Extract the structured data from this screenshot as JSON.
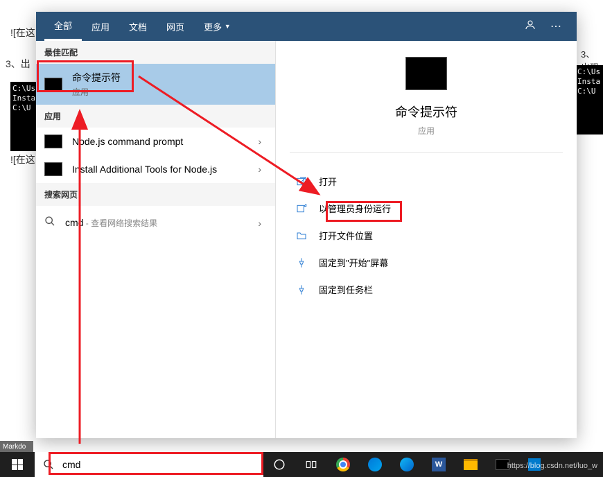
{
  "bg": {
    "text1": "![在这",
    "text2": "3、出",
    "text3": "3、出现",
    "text4": "![在这",
    "term1": "C:\\Us\nInsta\nC:\\U",
    "term2": "C:\\Us\nInsta\nC:\\U"
  },
  "tabs": {
    "all": "全部",
    "apps": "应用",
    "docs": "文档",
    "web": "网页",
    "more": "更多"
  },
  "sections": {
    "best_match": "最佳匹配",
    "apps": "应用",
    "search_web": "搜索网页"
  },
  "results": {
    "cmd": {
      "title": "命令提示符",
      "sub": "应用"
    },
    "nodejs": {
      "title": "Node.js command prompt"
    },
    "tools": {
      "title": "Install Additional Tools for Node.js"
    },
    "web": {
      "query": "cmd",
      "suffix": " - 查看网络搜索结果"
    }
  },
  "preview": {
    "title": "命令提示符",
    "sub": "应用"
  },
  "actions": {
    "open": "打开",
    "admin": "以管理员身份运行",
    "location": "打开文件位置",
    "pin_start": "固定到\"开始\"屏幕",
    "pin_taskbar": "固定到任务栏"
  },
  "search": {
    "value": "cmd"
  },
  "markdown": "Markdo",
  "watermark": "https://blog.csdn.net/luo_w"
}
